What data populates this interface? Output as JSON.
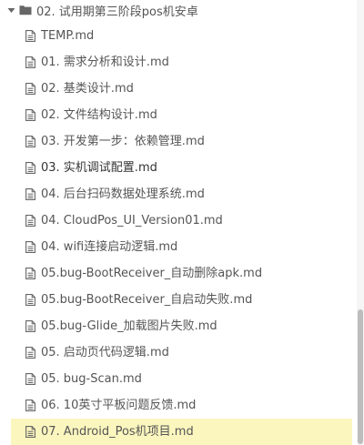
{
  "folder": {
    "label": "02. 试用期第三阶段pos机安卓",
    "expanded": true
  },
  "files": [
    {
      "label": "TEMP.md"
    },
    {
      "label": "01. 需求分析和设计.md"
    },
    {
      "label": "02. 基类设计.md"
    },
    {
      "label": "02. 文件结构设计.md"
    },
    {
      "label": "03. 开发第一步：依赖管理.md"
    },
    {
      "label": "03. 实机调试配置.md"
    },
    {
      "label": "04. 后台扫码数据处理系统.md"
    },
    {
      "label": "04. CloudPos_UI_Version01.md"
    },
    {
      "label": "04. wifi连接启动逻辑.md"
    },
    {
      "label": "05.bug-BootReceiver_自动删除apk.md"
    },
    {
      "label": "05.bug-BootReceiver_自启动失败.md"
    },
    {
      "label": "05.bug-Glide_加载图片失败.md"
    },
    {
      "label": "05. 启动页代码逻辑.md"
    },
    {
      "label": "05. bug-Scan.md"
    },
    {
      "label": "06. 10英寸平板问题反馈.md"
    },
    {
      "label": "07. Android_Pos机项目.md"
    }
  ],
  "selected_file": "07. Android_Pos机项目.md",
  "hovered_file": "03. 实机调试配置.md",
  "colors": {
    "selection_background": "#fbf6be",
    "text": "#555555",
    "icon": "#666666"
  }
}
